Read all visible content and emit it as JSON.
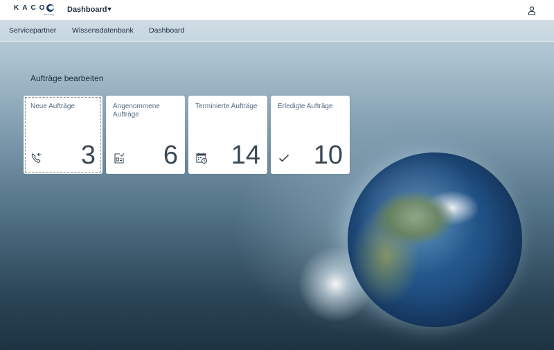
{
  "shell": {
    "logo_text": "KACO",
    "logo_subtext": "new energy",
    "app_title": "Dashboard"
  },
  "nav": {
    "items": [
      "Servicepartner",
      "Wissensdatenbank",
      "Dashboard"
    ]
  },
  "group": {
    "title": "Aufträge bearbeiten"
  },
  "tiles": [
    {
      "title": "Neue Aufträge",
      "count": "3",
      "icon": "phone-incoming-icon"
    },
    {
      "title": "Angenommene Aufträge",
      "count": "6",
      "icon": "document-check-icon"
    },
    {
      "title": "Terminierte Aufträge",
      "count": "14",
      "icon": "calendar-clock-icon"
    },
    {
      "title": "Erledigte Aufträge",
      "count": "10",
      "icon": "checkmark-icon"
    }
  ],
  "colors": {
    "shell_bg": "#ffffff",
    "text_dark": "#1d2d3e",
    "tile_title": "#556b82",
    "tile_number": "#3a4754",
    "brand_blue": "#1e3d6e"
  }
}
